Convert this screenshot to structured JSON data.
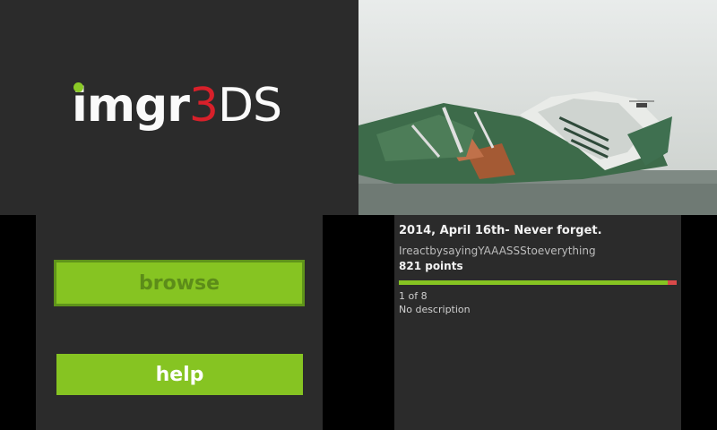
{
  "logo": {
    "part_a": "imgr",
    "part_b": "3",
    "part_c": "DS"
  },
  "menu": {
    "browse_label": "browse",
    "help_label": "help"
  },
  "post": {
    "title": "2014, April 16th- Never forget.",
    "user": "IreactbysayingYAAASSStoeverything",
    "points": "821 points",
    "score_ratio": 0.968,
    "index": "1 of 8",
    "description": "No description"
  },
  "colors": {
    "accent": "#86c422",
    "logo_red": "#d8202a",
    "panel": "#2b2b2b",
    "downvote": "#d94a4a"
  }
}
